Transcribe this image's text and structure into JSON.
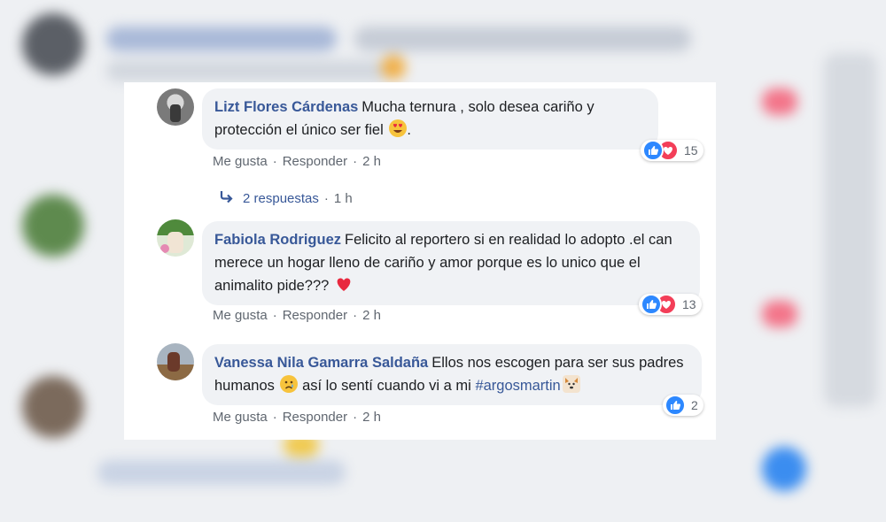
{
  "comments": [
    {
      "author": "Lizt Flores Cárdenas",
      "text": "Mucha ternura , solo desea cariño y protección el único ser fiel",
      "text_after_emoji": ".",
      "emoji": "heart-eyes-emoji",
      "reaction_count": "15",
      "reactions": [
        "like",
        "love"
      ],
      "actions": {
        "like": "Me gusta",
        "reply": "Responder",
        "time": "2 h"
      },
      "replies": {
        "label": "2 respuestas",
        "time": "1 h"
      }
    },
    {
      "author": "Fabiola Rodriguez",
      "text": "Felicito al reportero si en realidad lo adopto .el can merece un hogar lleno de cariño y amor porque es lo unico que el animalito pide???",
      "emoji": "red-heart-emoji",
      "reaction_count": "13",
      "reactions": [
        "like",
        "love"
      ],
      "actions": {
        "like": "Me gusta",
        "reply": "Responder",
        "time": "2 h"
      }
    },
    {
      "author": "Vanessa Nila Gamarra Saldaña",
      "text": "Ellos nos escogen para ser sus padres humanos",
      "emoji": "crying-face-emoji",
      "text2": "así lo sentí cuando vi a mi",
      "hashtag": "#argosmartin",
      "emoji2": "dog-face-emoji",
      "reaction_count": "2",
      "reactions": [
        "like"
      ],
      "actions": {
        "like": "Me gusta",
        "reply": "Responder",
        "time": "2 h"
      }
    }
  ],
  "separator": "·",
  "colors": {
    "author": "#385898",
    "bubble": "#f0f2f5",
    "meta": "#606770",
    "like": "#2d88ff",
    "love": "#f33e58"
  }
}
